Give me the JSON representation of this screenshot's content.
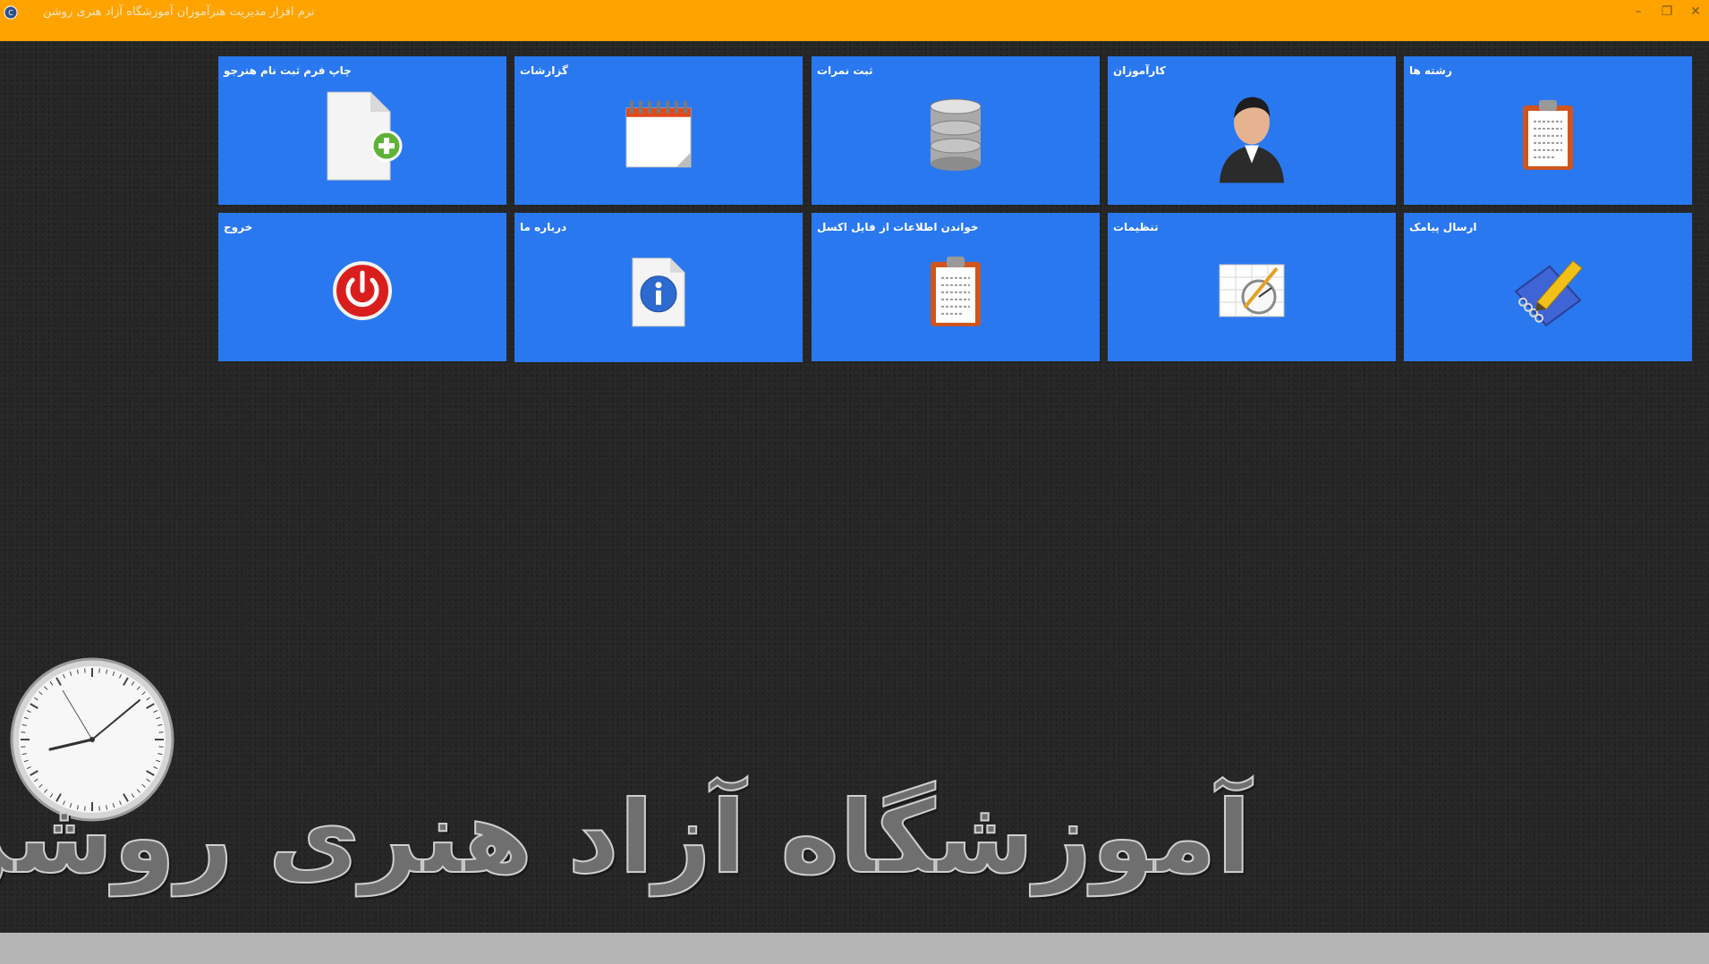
{
  "window": {
    "title": "نرم افزار مدیریت هنرآموزان آموزشگاه آزاد هنری روشن",
    "controls": {
      "minimize": "–",
      "restore": "❐",
      "close": "✕"
    }
  },
  "tiles": [
    {
      "label": "رشته ها",
      "icon": "clipboard-icon"
    },
    {
      "label": "کارآموزان",
      "icon": "user-icon"
    },
    {
      "label": "ثبت نمرات",
      "icon": "database-icon"
    },
    {
      "label": "گزارشات",
      "icon": "calendar-icon"
    },
    {
      "label": "چاپ فرم ثبت نام هنرجو",
      "icon": "new-document-icon"
    },
    {
      "label": "ارسال پیامک",
      "icon": "notepad-pencil-icon"
    },
    {
      "label": "تنظیمات",
      "icon": "settings-chart-icon"
    },
    {
      "label": "خواندن اطلاعات از فایل اکسل",
      "icon": "clipboard-icon"
    },
    {
      "label": "درباره ما",
      "icon": "info-icon"
    },
    {
      "label": "خروج",
      "icon": "power-icon"
    }
  ],
  "brand": {
    "text": "آموزشگاه آزاد هنری روشن"
  },
  "colors": {
    "titlebar": "#ffa300",
    "tile": "#2a78f0",
    "background": "#262626",
    "bottombar": "#b4b4b4"
  }
}
